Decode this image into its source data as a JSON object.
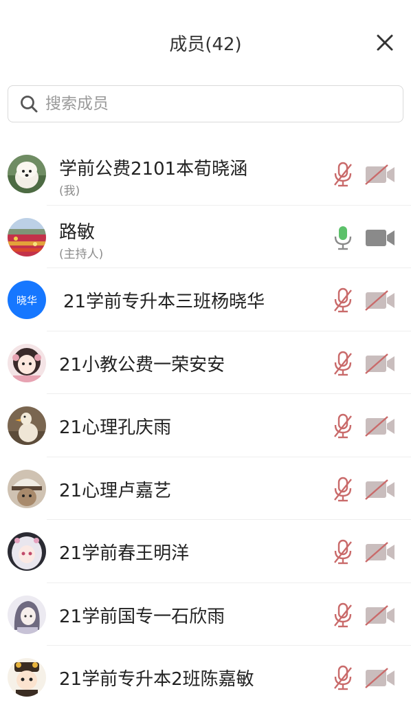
{
  "header": {
    "title": "成员(42)"
  },
  "search": {
    "placeholder": "搜索成员"
  },
  "members": [
    {
      "name": "学前公费2101本荀晓涵",
      "role": "(我)",
      "mic": "muted",
      "camera": "off",
      "avatar": "dog-photo"
    },
    {
      "name": "路敏",
      "role": "(主持人)",
      "mic": "active",
      "camera": "idle",
      "avatar": "flower-field-photo"
    },
    {
      "name": "21学前专升本三班杨晓华",
      "avatar_text": "晓华",
      "mic": "muted",
      "camera": "off",
      "avatar": "text-avatar"
    },
    {
      "name": "21小教公费一荣安安",
      "mic": "muted",
      "camera": "off",
      "avatar": "anime-girl"
    },
    {
      "name": "21心理孔庆雨",
      "mic": "muted",
      "camera": "off",
      "avatar": "duck-photo"
    },
    {
      "name": "21心理卢嘉艺",
      "mic": "muted",
      "camera": "off",
      "avatar": "hat-cartoon"
    },
    {
      "name": "21学前春王明洋",
      "mic": "muted",
      "camera": "off",
      "avatar": "anime-white-hair"
    },
    {
      "name": "21学前国专一石欣雨",
      "mic": "muted",
      "camera": "off",
      "avatar": "anime-sketch"
    },
    {
      "name": "21学前专升本2班陈嘉敏",
      "mic": "muted",
      "camera": "off",
      "avatar": "chibi-character"
    }
  ],
  "colors": {
    "muted_icon": "#c96a6a",
    "active_mic": "#5cc16a",
    "idle_camera": "#8a8a8a",
    "text_avatar_bg": "#1677ff"
  }
}
